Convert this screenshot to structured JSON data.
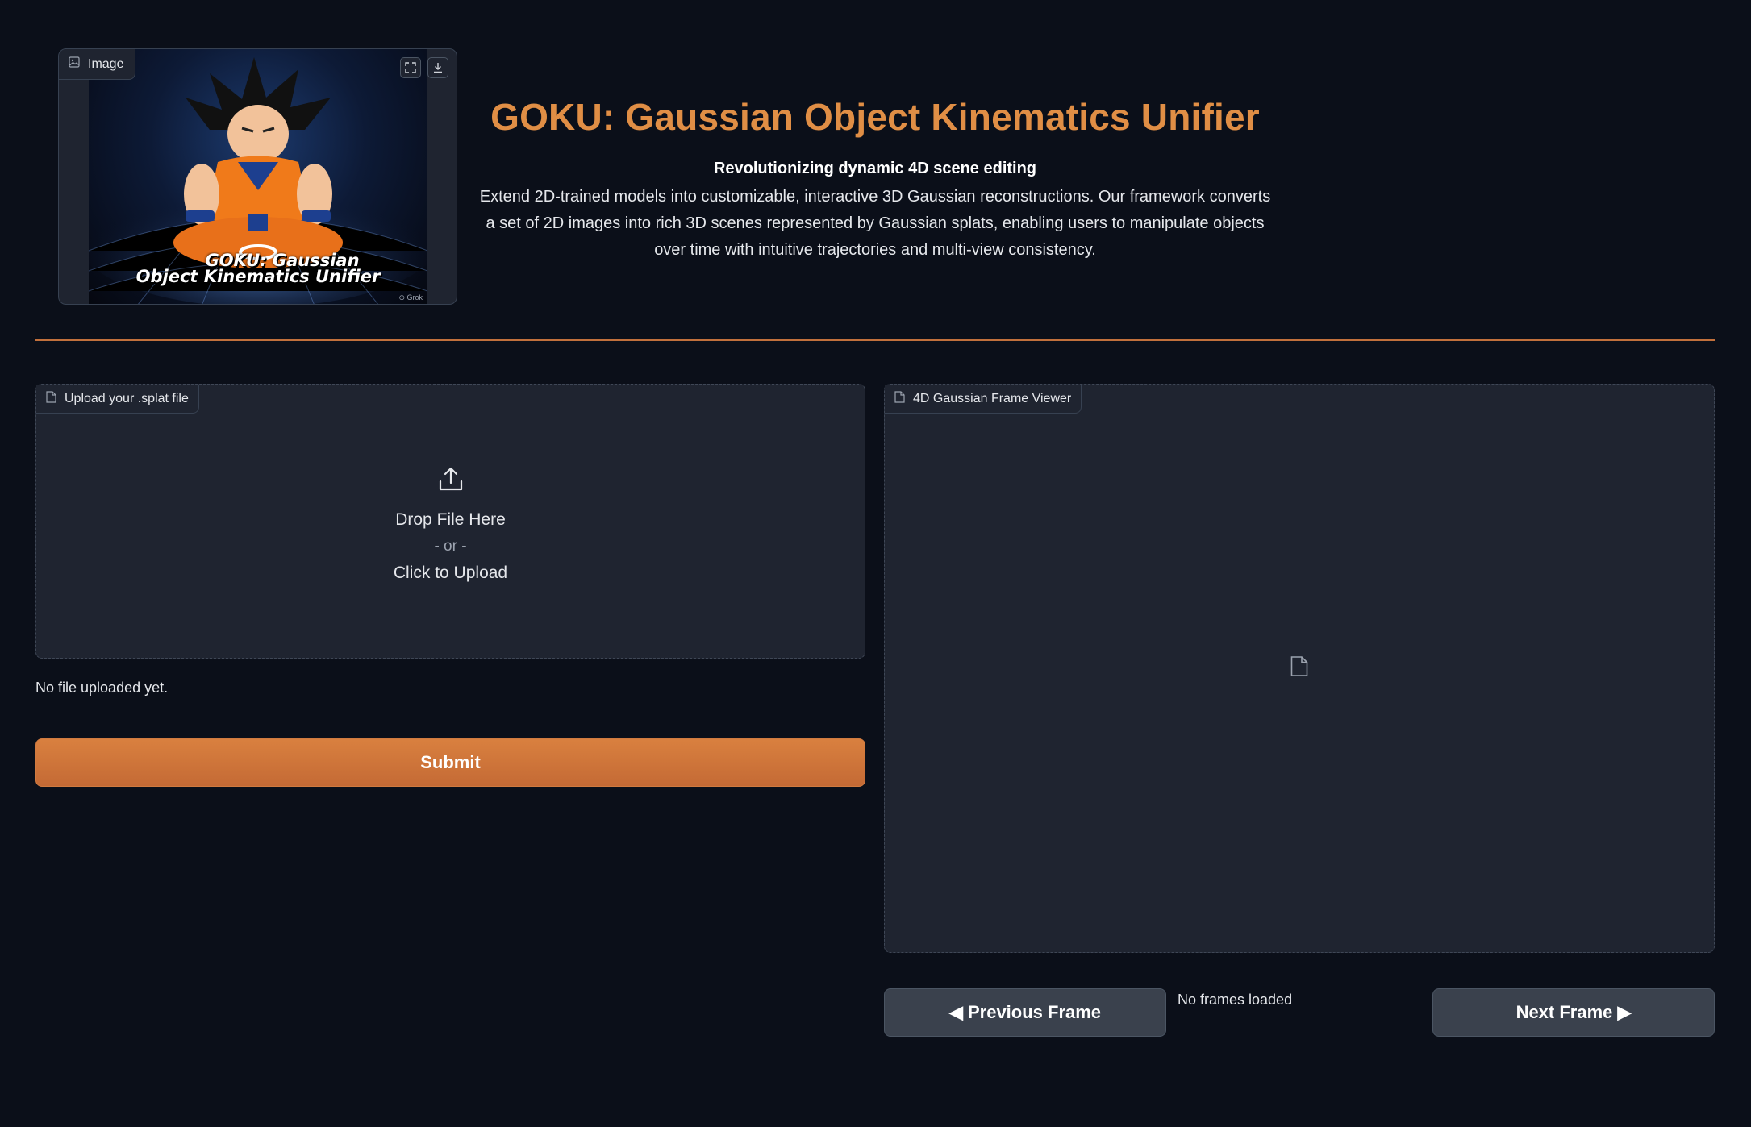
{
  "header": {
    "image_label": "Image",
    "image_label_icon": "image-icon",
    "image_actions": [
      "fullscreen-icon",
      "download-icon"
    ],
    "image_caption_line1": "GOKU: Gaussian",
    "image_caption_line2": "Object Kinematics Unifier",
    "title": "GOKU: Gaussian Object Kinematics Unifier",
    "subtitle": "Revolutionizing dynamic 4D scene editing",
    "description": "Extend 2D-trained models into customizable, interactive 3D Gaussian reconstructions. Our framework converts a set of 2D images into rich 3D scenes represented by Gaussian splats, enabling users to manipulate objects over time with intuitive trajectories and multi-view consistency."
  },
  "colors": {
    "accent": "#e08e45",
    "background": "#0b0f19",
    "panel": "#1f2430",
    "button": "#3a414d"
  },
  "upload": {
    "label": "Upload your .splat file",
    "label_icon": "file-icon",
    "drop_icon": "upload-icon",
    "drop_text": "Drop File Here",
    "or_text": "- or -",
    "click_text": "Click to Upload",
    "status": "No file uploaded yet.",
    "submit_label": "Submit"
  },
  "viewer": {
    "label": "4D Gaussian Frame Viewer",
    "label_icon": "file-icon",
    "placeholder_icon": "file-icon",
    "prev_label": "◀ Previous Frame",
    "next_label": "Next Frame ▶",
    "frames_status": "No frames loaded"
  }
}
